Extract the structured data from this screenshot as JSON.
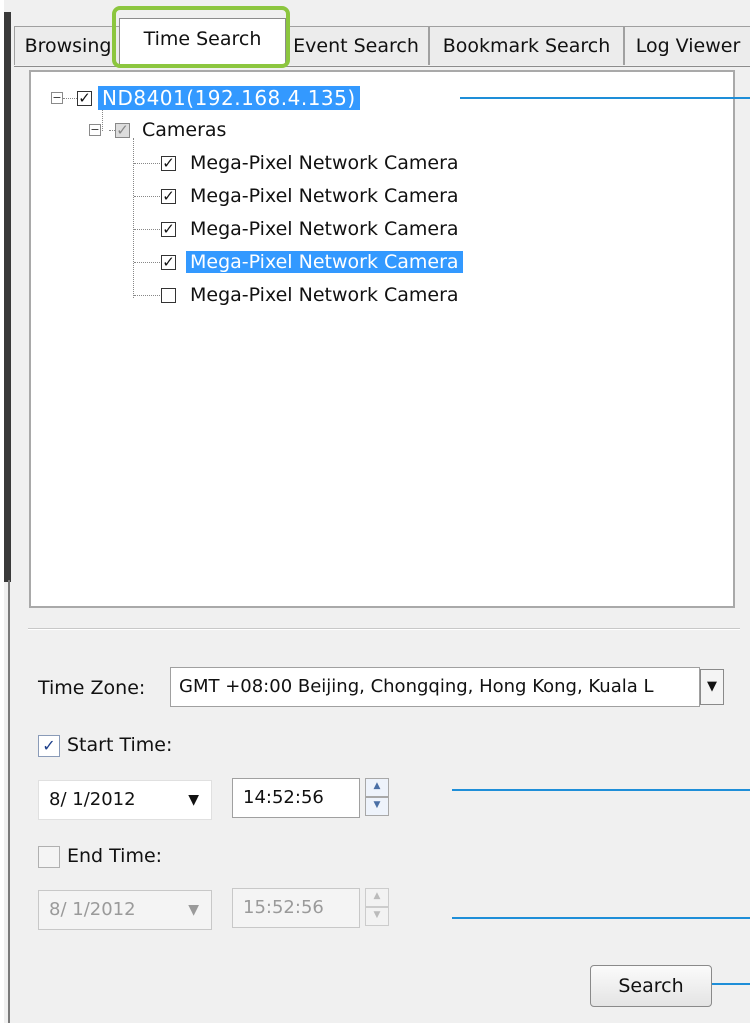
{
  "tabs": [
    {
      "label": "Browsing"
    },
    {
      "label": "Time Search"
    },
    {
      "label": "Event Search"
    },
    {
      "label": "Bookmark Search"
    },
    {
      "label": "Log Viewer"
    }
  ],
  "tree": {
    "root": {
      "label": "ND8401(192.168.4.135)",
      "checked": true
    },
    "group": {
      "label": "Cameras",
      "checked": true
    },
    "cameras": [
      {
        "label": "Mega-Pixel Network Camera",
        "checked": true
      },
      {
        "label": "Mega-Pixel Network Camera",
        "checked": true
      },
      {
        "label": "Mega-Pixel Network Camera",
        "checked": true
      },
      {
        "label": "Mega-Pixel Network Camera",
        "checked": true
      },
      {
        "label": "Mega-Pixel Network Camera",
        "checked": false
      }
    ]
  },
  "time_zone": {
    "label": "Time Zone:",
    "value": "GMT +08:00 Beijing, Chongqing, Hong Kong, Kuala L"
  },
  "start_time": {
    "label": "Start Time:",
    "checked": true,
    "date": "8/ 1/2012",
    "time": "14:52:56"
  },
  "end_time": {
    "label": "End Time:",
    "checked": false,
    "date": "8/ 1/2012",
    "time": "15:52:56"
  },
  "search_button": "Search",
  "colors": {
    "selection": "#3399ff",
    "tab_highlight": "#8cc63f",
    "callout": "#1e8ed8"
  },
  "icons": {
    "check": "check-icon",
    "dropdown": "chevron-down-icon",
    "spin_up": "arrow-up-icon",
    "spin_down": "arrow-down-icon",
    "expand": "minus-box-icon"
  }
}
